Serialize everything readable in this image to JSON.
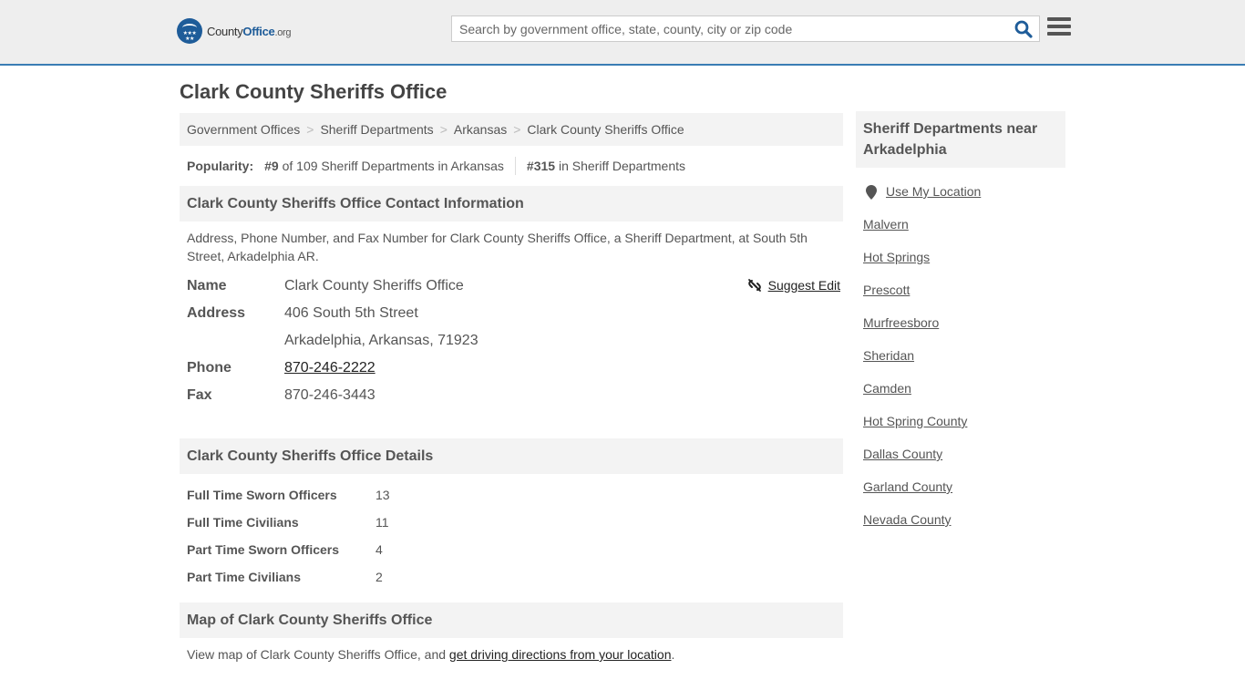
{
  "header": {
    "logo": {
      "prefix": "County",
      "brand": "Office",
      "suffix": ".org"
    },
    "search": {
      "placeholder": "Search by government office, state, county, city or zip code",
      "value": ""
    },
    "search_icon": "search-icon",
    "menu_icon": "hamburger-menu-icon"
  },
  "page": {
    "title": "Clark County Sheriffs Office"
  },
  "breadcrumb": [
    "Government Offices",
    "Sheriff Departments",
    "Arkansas",
    "Clark County Sheriffs Office"
  ],
  "popularity": {
    "label": "Popularity:",
    "state_rank": "#9",
    "state_text": "of 109 Sheriff Departments in Arkansas",
    "national_rank": "#315",
    "national_text": "in Sheriff Departments"
  },
  "contact": {
    "heading": "Clark County Sheriffs Office Contact Information",
    "description": "Address, Phone Number, and Fax Number for Clark County Sheriffs Office, a Sheriff Department, at South 5th Street, Arkadelphia AR.",
    "suggest_edit": "Suggest Edit",
    "rows": {
      "name_label": "Name",
      "name_value": "Clark County Sheriffs Office",
      "address_label": "Address",
      "address_line1": "406 South 5th Street",
      "address_line2": "Arkadelphia, Arkansas, 71923",
      "phone_label": "Phone",
      "phone_value": "870-246-2222",
      "fax_label": "Fax",
      "fax_value": "870-246-3443"
    }
  },
  "details": {
    "heading": "Clark County Sheriffs Office Details",
    "rows": [
      {
        "label": "Full Time Sworn Officers",
        "value": "13"
      },
      {
        "label": "Full Time Civilians",
        "value": "11"
      },
      {
        "label": "Part Time Sworn Officers",
        "value": "4"
      },
      {
        "label": "Part Time Civilians",
        "value": "2"
      }
    ]
  },
  "map": {
    "heading": "Map of Clark County Sheriffs Office",
    "text": "View map of Clark County Sheriffs Office, and ",
    "link": "get driving directions from your location",
    "end": "."
  },
  "sidebar": {
    "heading": "Sheriff Departments near Arkadelphia",
    "use_location": "Use My Location",
    "items": [
      "Malvern",
      "Hot Springs",
      "Prescott",
      "Murfreesboro",
      "Sheridan",
      "Camden",
      "Hot Spring County",
      "Dallas County",
      "Garland County",
      "Nevada County"
    ]
  },
  "colors": {
    "brand_blue": "#1e5c99",
    "header_border": "#3a7db4",
    "panel_bg": "#f3f3f3"
  }
}
